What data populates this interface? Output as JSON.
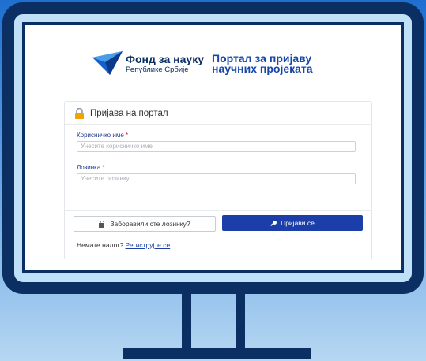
{
  "brand": {
    "name": "Фонд за науку",
    "subtitle": "Републике Србије",
    "portal_line1": "Портал за пријаву",
    "portal_line2": "научних пројеката"
  },
  "login": {
    "title": "Пријава на портал",
    "username_label": "Корисничко име",
    "username_placeholder": "Унесите корисничко име",
    "password_label": "Лозинка",
    "password_placeholder": "Унесите лозинку",
    "required_mark": "*",
    "forgot_label": "Заборавили сте лозинку?",
    "login_label": "Пријави се",
    "no_account_text": "Немате налог?",
    "register_label": "Региструјте се"
  },
  "icons": [
    "logo-icon",
    "lock-icon",
    "key-icon",
    "sign-in-icon"
  ],
  "colors": {
    "monitor_frame": "#0b2e63",
    "primary_button": "#1c3ea8",
    "background_top": "#1e6fd0"
  }
}
